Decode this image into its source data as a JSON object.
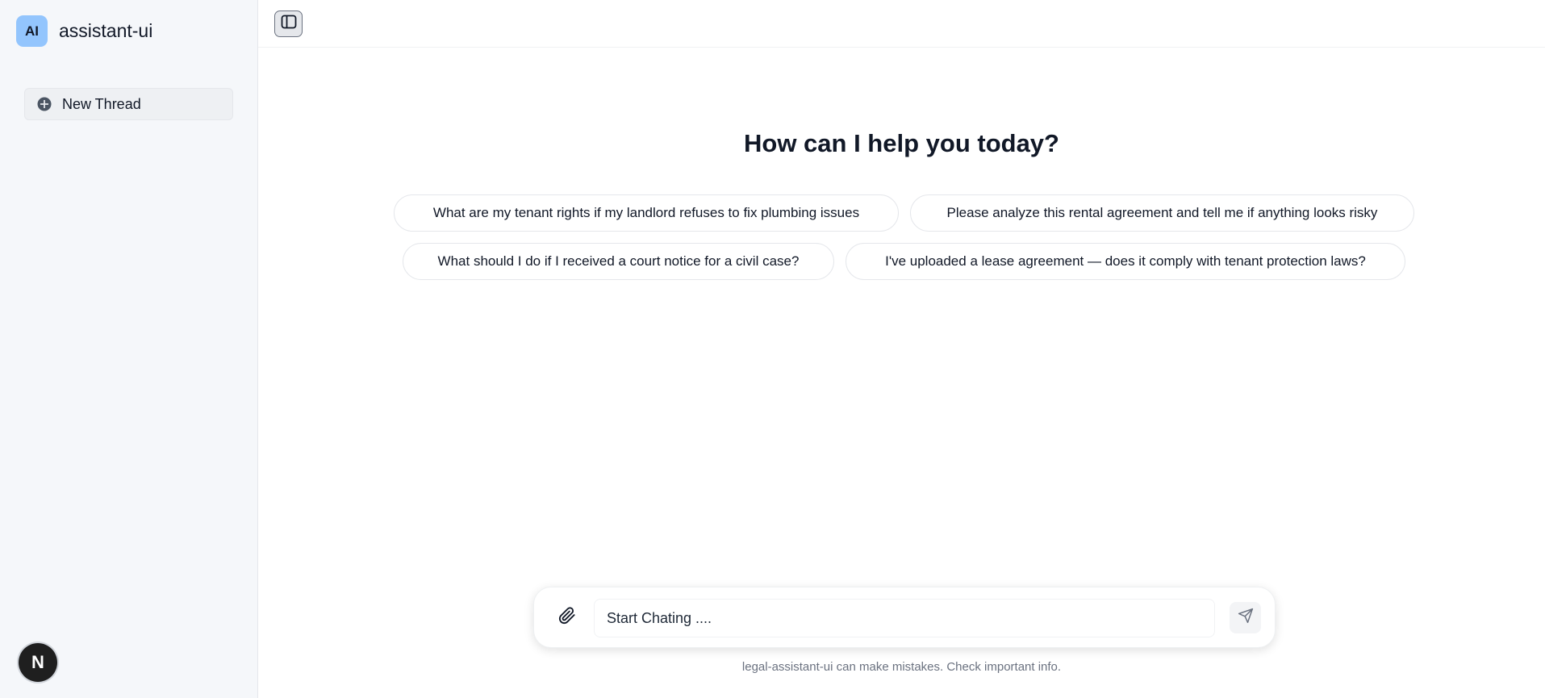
{
  "sidebar": {
    "brand": {
      "avatar_text": "AI",
      "name": "assistant-ui"
    },
    "new_thread_label": "New Thread",
    "plus_icon": "plus-circle-icon",
    "user_avatar_text": "N"
  },
  "topbar": {
    "toggle_icon": "sidebar-toggle-icon"
  },
  "main": {
    "heading": "How can I help you today?",
    "suggestions": [
      "What are my tenant rights if my landlord refuses to fix plumbing issues",
      "Please analyze this rental agreement and tell me if anything looks risky",
      "What should I do if I received a court notice for a civil case?",
      "I've uploaded a lease agreement — does it comply with tenant protection laws?"
    ]
  },
  "composer": {
    "placeholder": "Start Chating ....",
    "attach_icon": "paperclip-icon",
    "send_icon": "send-icon"
  },
  "footer": {
    "disclaimer": "legal-assistant-ui can make mistakes. Check important info."
  },
  "colors": {
    "sidebar_bg": "#f5f7fa",
    "brand_avatar_bg": "#93c5fd",
    "text": "#111827",
    "muted_text": "#6b7280"
  }
}
